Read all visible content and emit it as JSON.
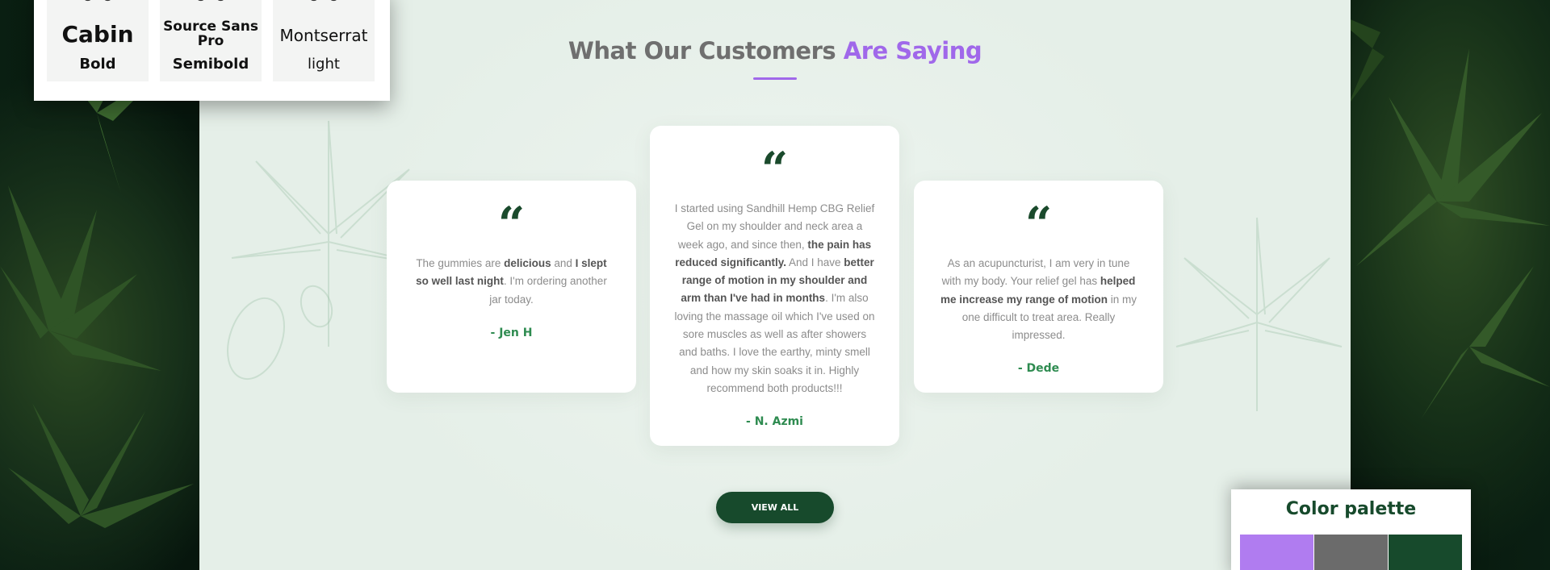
{
  "section": {
    "heading_main": "What Our Customers",
    "heading_accent": "Are Saying",
    "view_all_label": "VIEW ALL"
  },
  "testimonials": [
    {
      "quote_mark": "“",
      "segments": [
        {
          "text": "The gummies are ",
          "bold": false
        },
        {
          "text": "delicious",
          "bold": true
        },
        {
          "text": " and ",
          "bold": false
        },
        {
          "text": "I slept so well last night",
          "bold": true
        },
        {
          "text": ". I'm ordering another jar today.",
          "bold": false
        }
      ],
      "author": "- Jen H"
    },
    {
      "quote_mark": "“",
      "segments": [
        {
          "text": "I started using Sandhill Hemp CBG Relief Gel on my shoulder and neck area a week ago, and since then, ",
          "bold": false
        },
        {
          "text": "the pain has reduced significantly.",
          "bold": true
        },
        {
          "text": " And I have ",
          "bold": false
        },
        {
          "text": "better range of motion in my shoulder and arm than I've had in months",
          "bold": true
        },
        {
          "text": ". I'm also loving the massage oil which I've used on sore muscles as well as after showers and baths. I love the earthy, minty smell and how my skin soaks it in. Highly recommend both products!!!",
          "bold": false
        }
      ],
      "author": "- N. Azmi"
    },
    {
      "quote_mark": "“",
      "segments": [
        {
          "text": "As an acupuncturist, I am very in tune with my body. Your relief gel has ",
          "bold": false
        },
        {
          "text": "helped me increase my range of motion",
          "bold": true
        },
        {
          "text": " in my one difficult to treat area. Really impressed.",
          "bold": false
        }
      ],
      "author": "- Dede"
    }
  ],
  "font_specimens": [
    {
      "name": "Cabin",
      "weight": "Bold"
    },
    {
      "name": "Source Sans Pro",
      "weight": "Semibold"
    },
    {
      "name": "Montserrat",
      "weight": "light"
    }
  ],
  "palette": {
    "title": "Color palette",
    "colors": [
      "#b07cf0",
      "#6b6b6b",
      "#174a2c"
    ]
  },
  "colors": {
    "accent_purple": "#a068ea",
    "dark_green": "#174a2c",
    "author_green": "#2e8b50",
    "panel_bg": "#e5efe8"
  }
}
